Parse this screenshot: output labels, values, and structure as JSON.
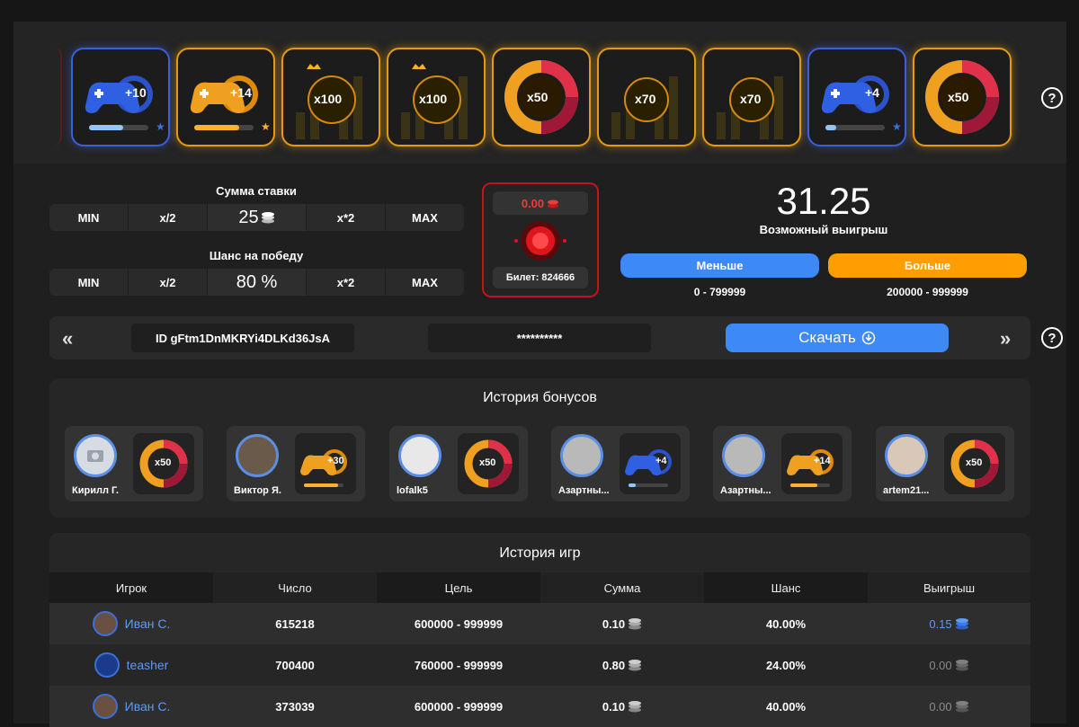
{
  "carousel": {
    "cards": [
      {
        "kind": "controller",
        "color": "blue",
        "label": "+10"
      },
      {
        "kind": "controller",
        "color": "gold",
        "label": "+14"
      },
      {
        "kind": "crown-chart",
        "color": "gold",
        "label": "x100"
      },
      {
        "kind": "crown-chart",
        "color": "gold",
        "label": "x100"
      },
      {
        "kind": "wheel",
        "color": "gold",
        "label": "x50"
      },
      {
        "kind": "chart",
        "color": "gold",
        "label": "x70"
      },
      {
        "kind": "chart",
        "color": "gold",
        "label": "x70"
      },
      {
        "kind": "controller",
        "color": "blue",
        "label": "+4"
      },
      {
        "kind": "wheel",
        "color": "gold",
        "label": "x50"
      }
    ],
    "help": "?"
  },
  "bet": {
    "amount_label": "Сумма ставки",
    "amount_value": "25",
    "chance_label": "Шанс на победу",
    "chance_value": "80 %",
    "btn_min": "MIN",
    "btn_half": "x/2",
    "btn_double": "x*2",
    "btn_max": "MAX"
  },
  "ticket": {
    "amount": "0.00",
    "ticket_text": "Билет: 824666"
  },
  "win": {
    "value": "31.25",
    "label": "Возможный выигрыш",
    "less_label": "Меньше",
    "more_label": "Больше",
    "less_range": "0 - 799999",
    "more_range": "200000 - 999999"
  },
  "seed": {
    "id_text": "ID gFtm1DnMKRYi4DLKd36JsA",
    "hidden_text": "**********",
    "download_label": "Скачать",
    "prev": "«",
    "next": "»"
  },
  "bonus_history": {
    "title": "История бонусов",
    "items": [
      {
        "name": "Кирилл Г.",
        "prize": "x50",
        "kind": "wheel"
      },
      {
        "name": "Виктор Я.",
        "prize": "+30",
        "kind": "controller-gold"
      },
      {
        "name": "lofalk5",
        "prize": "x50",
        "kind": "wheel"
      },
      {
        "name": "Азартны...",
        "prize": "+4",
        "kind": "controller-blue"
      },
      {
        "name": "Азартны...",
        "prize": "+14",
        "kind": "controller-gold"
      },
      {
        "name": "artem21...",
        "prize": "x50",
        "kind": "wheel"
      }
    ]
  },
  "game_history": {
    "title": "История игр",
    "headers": [
      "Игрок",
      "Число",
      "Цель",
      "Сумма",
      "Шанс",
      "Выигрыш"
    ],
    "rows": [
      {
        "player": "Иван С.",
        "number": "615218",
        "target": "600000 - 999999",
        "sum": "0.10",
        "chance": "40.00%",
        "win": "0.15",
        "won": true
      },
      {
        "player": "teasher",
        "number": "700400",
        "target": "760000 - 999999",
        "sum": "0.80",
        "chance": "24.00%",
        "win": "0.00",
        "won": false
      },
      {
        "player": "Иван С.",
        "number": "373039",
        "target": "600000 - 999999",
        "sum": "0.10",
        "chance": "40.00%",
        "win": "0.00",
        "won": false
      }
    ]
  },
  "colors": {
    "accent_blue": "#3d8af7",
    "accent_orange": "#ff9e00",
    "danger_red": "#c4141b"
  }
}
